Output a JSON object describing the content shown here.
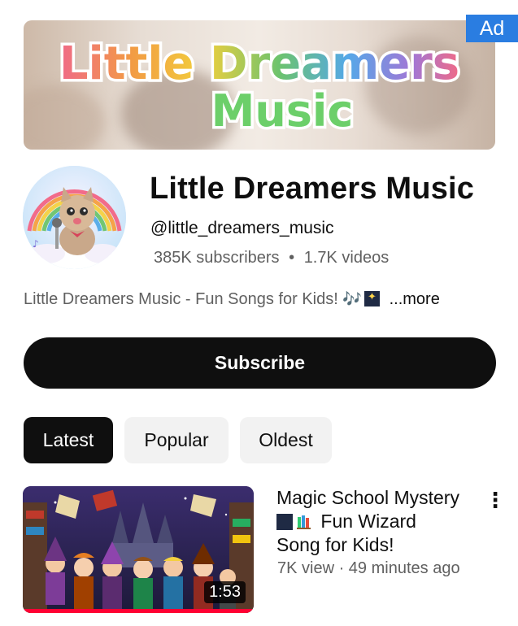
{
  "ad": {
    "label": "Ad"
  },
  "banner": {
    "line1": "Little Dreamers",
    "line2": "Music"
  },
  "channel": {
    "name": "Little Dreamers Music",
    "handle": "@little_dreamers_music",
    "subscribers": "385K",
    "subscribers_label": "subscribers",
    "separator": "•",
    "videos": "1.7K videos",
    "description": "Little Dreamers Music - Fun Songs for Kids!",
    "description_emoji": "🎶",
    "more_label": "...more"
  },
  "subscribe": {
    "label": "Subscribe"
  },
  "filters": [
    {
      "label": "Latest",
      "active": true
    },
    {
      "label": "Popular",
      "active": false
    },
    {
      "label": "Oldest",
      "active": false
    }
  ],
  "video": {
    "title_line1": "Magic School Mystery",
    "title_line2": "Fun Wizard",
    "title_line3": "Song for Kids!",
    "meta": "7K view · 49 minutes ago",
    "duration": "1:53",
    "progress": 1.0
  },
  "colors": {
    "accent_red": "#ff0033",
    "ad_blue": "#2a7de1",
    "dark": "#0f0f0f",
    "chip_gray": "#f2f2f2",
    "muted_text": "#606060"
  },
  "icons": {
    "kebab": "more-vert-icon",
    "notes": "musical-notes-icon",
    "sparkles": "sparkle-night-icon",
    "books": "books-icon"
  }
}
